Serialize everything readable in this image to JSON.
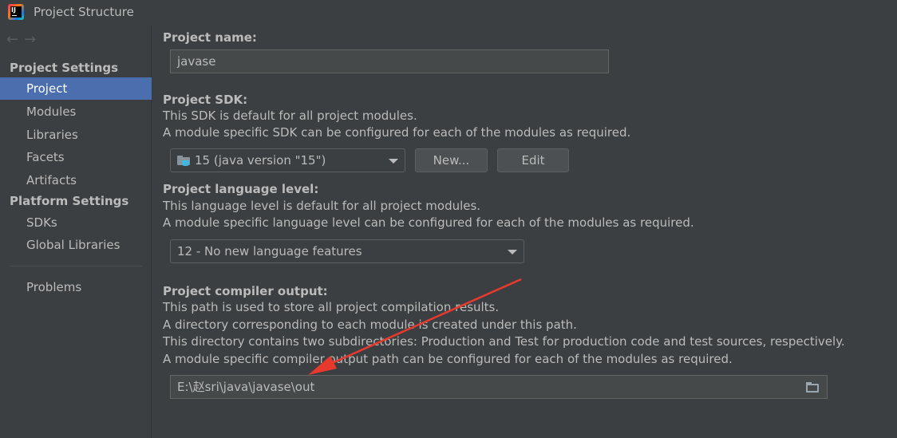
{
  "window": {
    "title": "Project Structure",
    "app_icon_text": "IJ"
  },
  "nav": {
    "back": "←",
    "forward": "→"
  },
  "sidebar": {
    "project_settings_header": "Project Settings",
    "project_settings_items": [
      {
        "label": "Project",
        "selected": true
      },
      {
        "label": "Modules",
        "selected": false
      },
      {
        "label": "Libraries",
        "selected": false
      },
      {
        "label": "Facets",
        "selected": false
      },
      {
        "label": "Artifacts",
        "selected": false
      }
    ],
    "platform_settings_header": "Platform Settings",
    "platform_settings_items": [
      {
        "label": "SDKs"
      },
      {
        "label": "Global Libraries"
      }
    ],
    "problems_label": "Problems"
  },
  "project_name": {
    "label": "Project name:",
    "value": "javase"
  },
  "project_sdk": {
    "label": "Project SDK:",
    "desc1": "This SDK is default for all project modules.",
    "desc2": "A module specific SDK can be configured for each of the modules as required.",
    "selected": "15 (java version \"15\")",
    "new_button": "New...",
    "edit_button": "Edit"
  },
  "language_level": {
    "label": "Project language level:",
    "desc1": "This language level is default for all project modules.",
    "desc2": "A module specific language level can be configured for each of the modules as required.",
    "selected": "12 - No new language features"
  },
  "compiler_output": {
    "label": "Project compiler output:",
    "desc1": "This path is used to store all project compilation results.",
    "desc2": "A directory corresponding to each module is created under this path.",
    "desc3": "This directory contains two subdirectories: Production and Test for production code and test sources, respectively.",
    "desc4": "A module specific compiler output path can be configured for each of the modules as required.",
    "value": "E:\\赵sri\\java\\javase\\out"
  },
  "colors": {
    "background": "#3c3f41",
    "selection": "#4b6eaf",
    "annotation_arrow": "#e8392f"
  }
}
